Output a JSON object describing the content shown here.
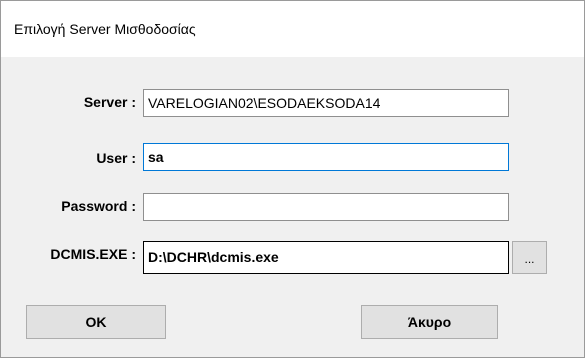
{
  "window": {
    "title": "Επιλογή Server Μισθοδοσίας"
  },
  "form": {
    "server": {
      "label": "Server :",
      "value": "VARELOGIAN02\\ESODAEKSODA14"
    },
    "user": {
      "label": "User :",
      "value": "sa"
    },
    "password": {
      "label": "Password :",
      "value": ""
    },
    "dcmis": {
      "label": "DCMIS.EXE :",
      "value": "D:\\DCHR\\dcmis.exe",
      "browse_label": "..."
    }
  },
  "buttons": {
    "ok_label": "OK",
    "cancel_label": "Άκυρο"
  }
}
